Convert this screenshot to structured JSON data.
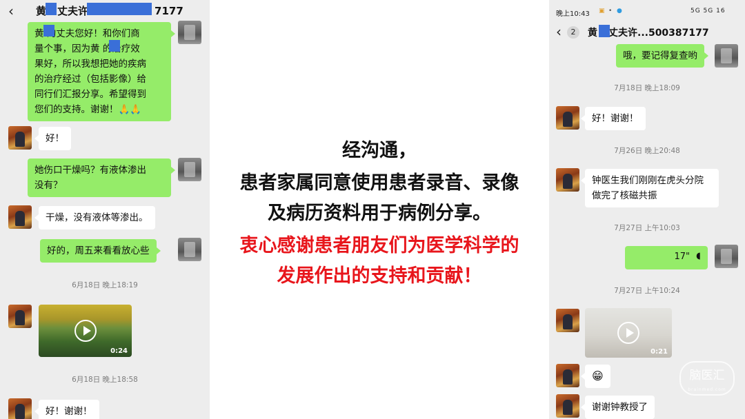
{
  "left_chat": {
    "header": {
      "title_prefix": "黄",
      "title_suffix": "丈夫许",
      "title_end": "7177"
    },
    "messages": {
      "m1": "黄    的丈夫您好！和你们商\n量个事，因为黄    的治疗效\n果好，所以我想把她的疾病\n的治疗经过（包括影像）给\n同行们汇报分享。希望得到\n您们的支持。谢谢！🙏🙏",
      "m2": "好！",
      "m3": "她伤口干燥吗？有液体渗出\n没有？",
      "m4": "干燥，没有液体等渗出。",
      "m5": "好的，周五来看看放心些",
      "ts1": "6月18日 晚上18:19",
      "video_duration": "0:24",
      "ts2": "6月18日 晚上18:58",
      "m6": "好！谢谢！"
    }
  },
  "center": {
    "line1": "经沟通，",
    "line2": "患者家属同意使用患者录音、录像",
    "line3": "及病历资料用于病例分享。",
    "line4": "衷心感谢患者朋友们为医学科学的",
    "line5": "发展作出的支持和贡献！"
  },
  "right_chat": {
    "status": {
      "time": "晚上10:43",
      "right": "5G 5G 16"
    },
    "header": {
      "unread": "2",
      "title_prefix": "黄",
      "title_suffix": "丈夫许...500387177"
    },
    "messages": {
      "m1": "哦，要记得复查哟",
      "ts1": "7月18日 晚上18:09",
      "m2": "好！谢谢！",
      "ts2": "7月26日 晚上20:48",
      "m3": "钟医生我们刚刚在虎头分院\n做完了核磁共振",
      "ts3": "7月27日 上午10:03",
      "voice_duration": "17\"",
      "ts4": "7月27日 上午10:24",
      "video_duration": "0:21",
      "m4": "😁",
      "m5": "谢谢钟教授了"
    }
  },
  "watermark": {
    "text": "脑医汇",
    "sub": "brainmed.com"
  },
  "colors": {
    "green_bubble": "#95ec69",
    "chat_bg": "#ededed",
    "red_text": "#e8161c",
    "redact_blue": "#3a6fd8"
  }
}
